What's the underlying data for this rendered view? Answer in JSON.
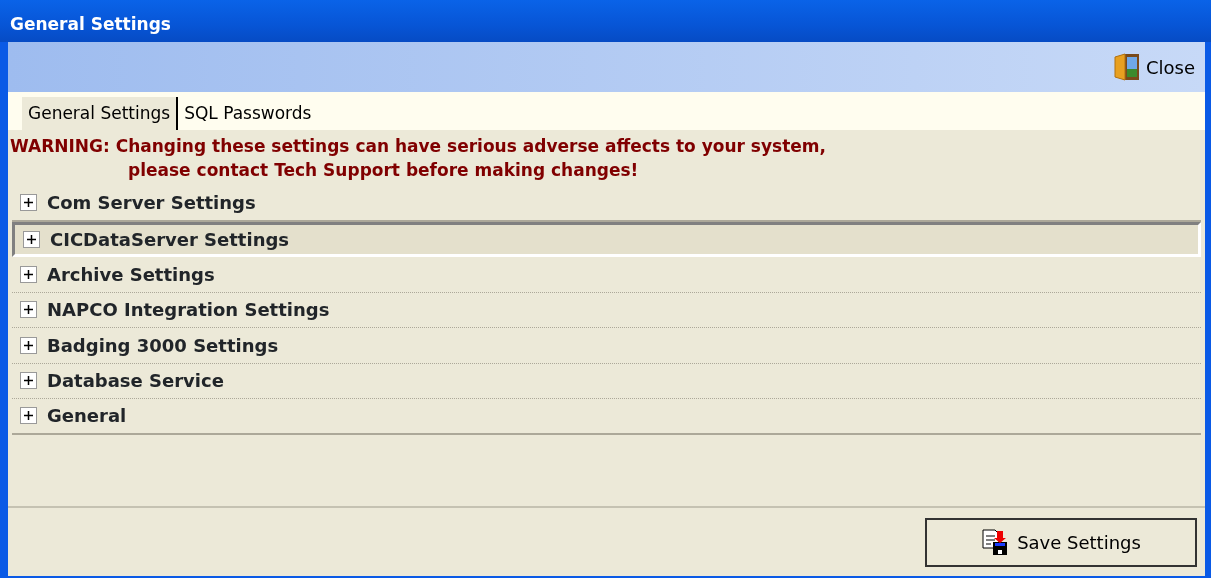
{
  "window": {
    "title": "General Settings"
  },
  "toolbar": {
    "close_label": "Close"
  },
  "tabs": [
    {
      "label": "General Settings",
      "selected": true
    },
    {
      "label": "SQL Passwords",
      "selected": false
    }
  ],
  "warning": [
    "WARNING: Changing these settings can have serious adverse affects to your system,",
    "please contact Tech Support before making changes!"
  ],
  "sections": [
    {
      "label": "Com Server Settings",
      "expanded": false,
      "selected": false
    },
    {
      "label": "CICDataServer Settings",
      "expanded": false,
      "selected": true
    },
    {
      "label": "Archive Settings",
      "expanded": false,
      "selected": false
    },
    {
      "label": "NAPCO Integration Settings",
      "expanded": false,
      "selected": false
    },
    {
      "label": "Badging 3000 Settings",
      "expanded": false,
      "selected": false
    },
    {
      "label": "Database Service",
      "expanded": false,
      "selected": false
    },
    {
      "label": "General",
      "expanded": false,
      "selected": false
    }
  ],
  "save_button": {
    "label": "Save Settings"
  }
}
